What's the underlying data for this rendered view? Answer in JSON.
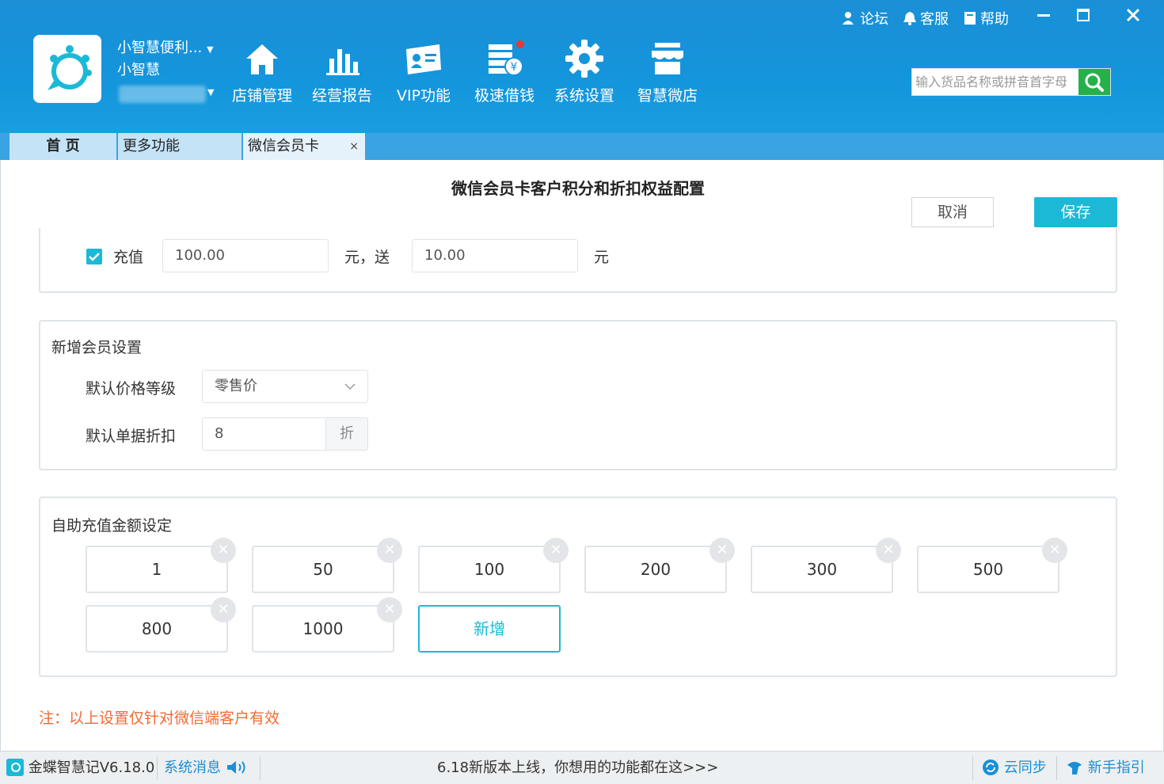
{
  "header": {
    "store_name": "小智慧便利...",
    "user_name": "小智慧",
    "nav": [
      {
        "label": "店铺管理",
        "icon": "home-icon"
      },
      {
        "label": "经营报告",
        "icon": "bar-chart-icon"
      },
      {
        "label": "VIP功能",
        "icon": "vip-card-icon"
      },
      {
        "label": "极速借钱",
        "icon": "loan-icon"
      },
      {
        "label": "系统设置",
        "icon": "gear-icon"
      },
      {
        "label": "智慧微店",
        "icon": "shop-icon"
      }
    ],
    "top_links": {
      "forum": "论坛",
      "service": "客服",
      "help": "帮助"
    },
    "search_placeholder": "输入货品名称或拼音首字母"
  },
  "tabs": [
    {
      "label": "首 页"
    },
    {
      "label": "更多功能"
    },
    {
      "label": "微信会员卡",
      "close": "×"
    }
  ],
  "page": {
    "title": "微信会员卡客户积分和折扣权益配置",
    "cancel": "取消",
    "save": "保存"
  },
  "recharge": {
    "label": "充值",
    "amount": "100.00",
    "mid_text": "元，送",
    "bonus": "10.00",
    "unit": "元",
    "checked": true
  },
  "new_member": {
    "title": "新增会员设置",
    "price_label": "默认价格等级",
    "price_value": "零售价",
    "discount_label": "默认单据折扣",
    "discount_value": "8",
    "discount_unit": "折"
  },
  "self_recharge": {
    "title": "自助充值金额设定",
    "amounts": [
      "1",
      "50",
      "100",
      "200",
      "300",
      "500",
      "800",
      "1000"
    ],
    "add_label": "新增"
  },
  "note": "注：以上设置仅针对微信端客户有效",
  "status_bar": {
    "version": "金蝶智慧记V6.18.0",
    "messages": "系统消息",
    "announcement": "6.18新版本上线，你想用的功能都在这>>>",
    "sync": "云同步",
    "guide": "新手指引"
  },
  "colors": {
    "header_blue": "#1495dc",
    "accent_cyan": "#1cb9d7",
    "search_green": "#26b04a",
    "note_orange": "#f36a34"
  }
}
